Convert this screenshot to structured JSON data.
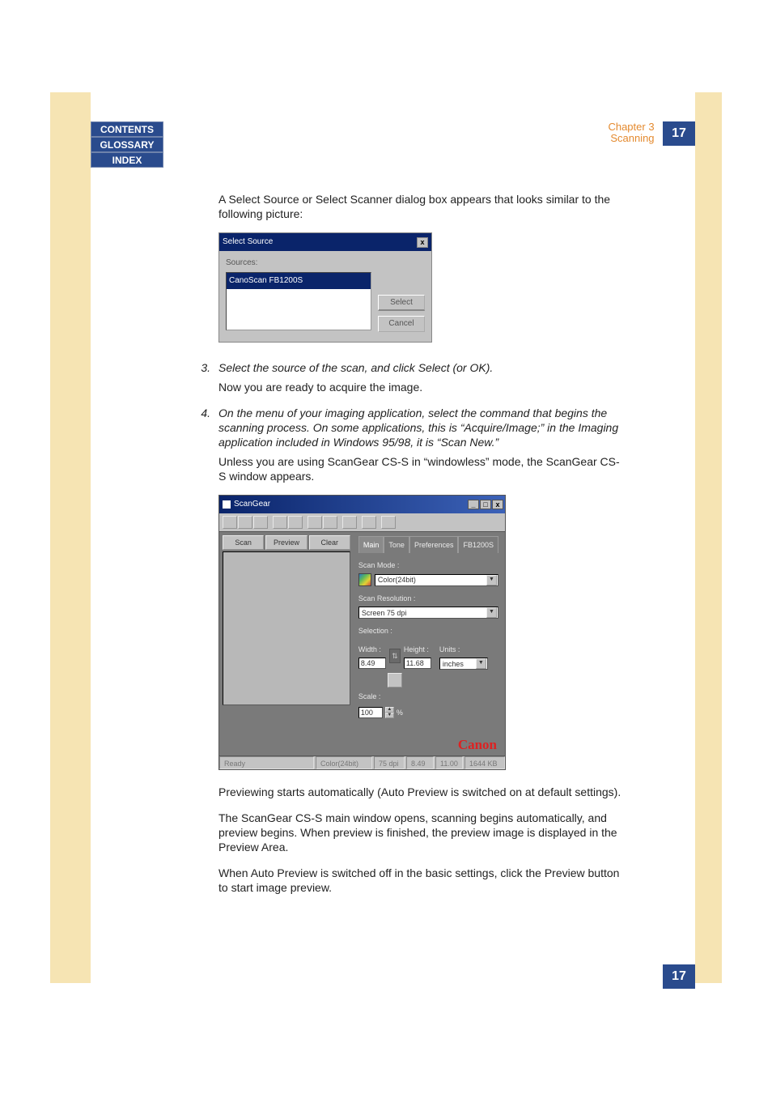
{
  "nav": {
    "contents": "CONTENTS",
    "glossary": "GLOSSARY",
    "index": "INDEX"
  },
  "header": {
    "chapter": "Chapter 3",
    "title": "Scanning",
    "page": "17"
  },
  "intro": "A Select Source or Select Scanner dialog box appears that looks similar to the following picture:",
  "dlg1": {
    "title": "Select Source",
    "close": "x",
    "sources_label": "Sources:",
    "source_item": "CanoScan FB1200S",
    "select_btn": "Select",
    "cancel_btn": "Cancel"
  },
  "step3_num": "3.",
  "step3_text": "Select the source of the scan, and click Select (or OK).",
  "step3_follow": "Now you are ready to acquire the image.",
  "step4_num": "4.",
  "step4_text": "On the menu of your imaging application, select the command that begins the scanning process. On some applications, this is “Acquire/Image;” in the Imaging application included in Windows 95/98, it is “Scan New.”",
  "step4_follow": "Unless you are using ScanGear CS-S in “windowless” mode, the ScanGear CS-S window appears.",
  "dlg2": {
    "title": "ScanGear",
    "tab_scan": "Scan",
    "tab_preview": "Preview",
    "tab_clear": "Clear",
    "tabs": {
      "main": "Main",
      "tone": "Tone",
      "preferences": "Preferences",
      "device": "FB1200S"
    },
    "scanmode_label": "Scan Mode :",
    "scanmode_value": "Color(24bit)",
    "scanres_label": "Scan Resolution :",
    "scanres_value": "Screen 75 dpi",
    "selection_label": "Selection :",
    "width_label": "Width :",
    "height_label": "Height :",
    "units_label": "Units :",
    "width_value": "8.49",
    "height_value": "11.68",
    "units_value": "inches",
    "scale_label": "Scale :",
    "scale_value": "100",
    "scale_pct": "%",
    "brand": "Canon",
    "status_ready": "Ready",
    "status_mode": "Color(24bit)",
    "status_dpi": "75 dpi",
    "status_w": "8.49",
    "status_h": "11.00",
    "status_size": "1644 KB"
  },
  "para_preview": "Previewing starts automatically (Auto Preview is switched on at default settings).",
  "para_main": "The ScanGear CS-S main window opens, scanning begins automatically, and preview begins.  When preview is finished, the preview image is displayed in the Preview Area.",
  "para_off": "When Auto Preview is switched off in the basic settings, click the Preview button to start image preview.",
  "footer_page": "17"
}
